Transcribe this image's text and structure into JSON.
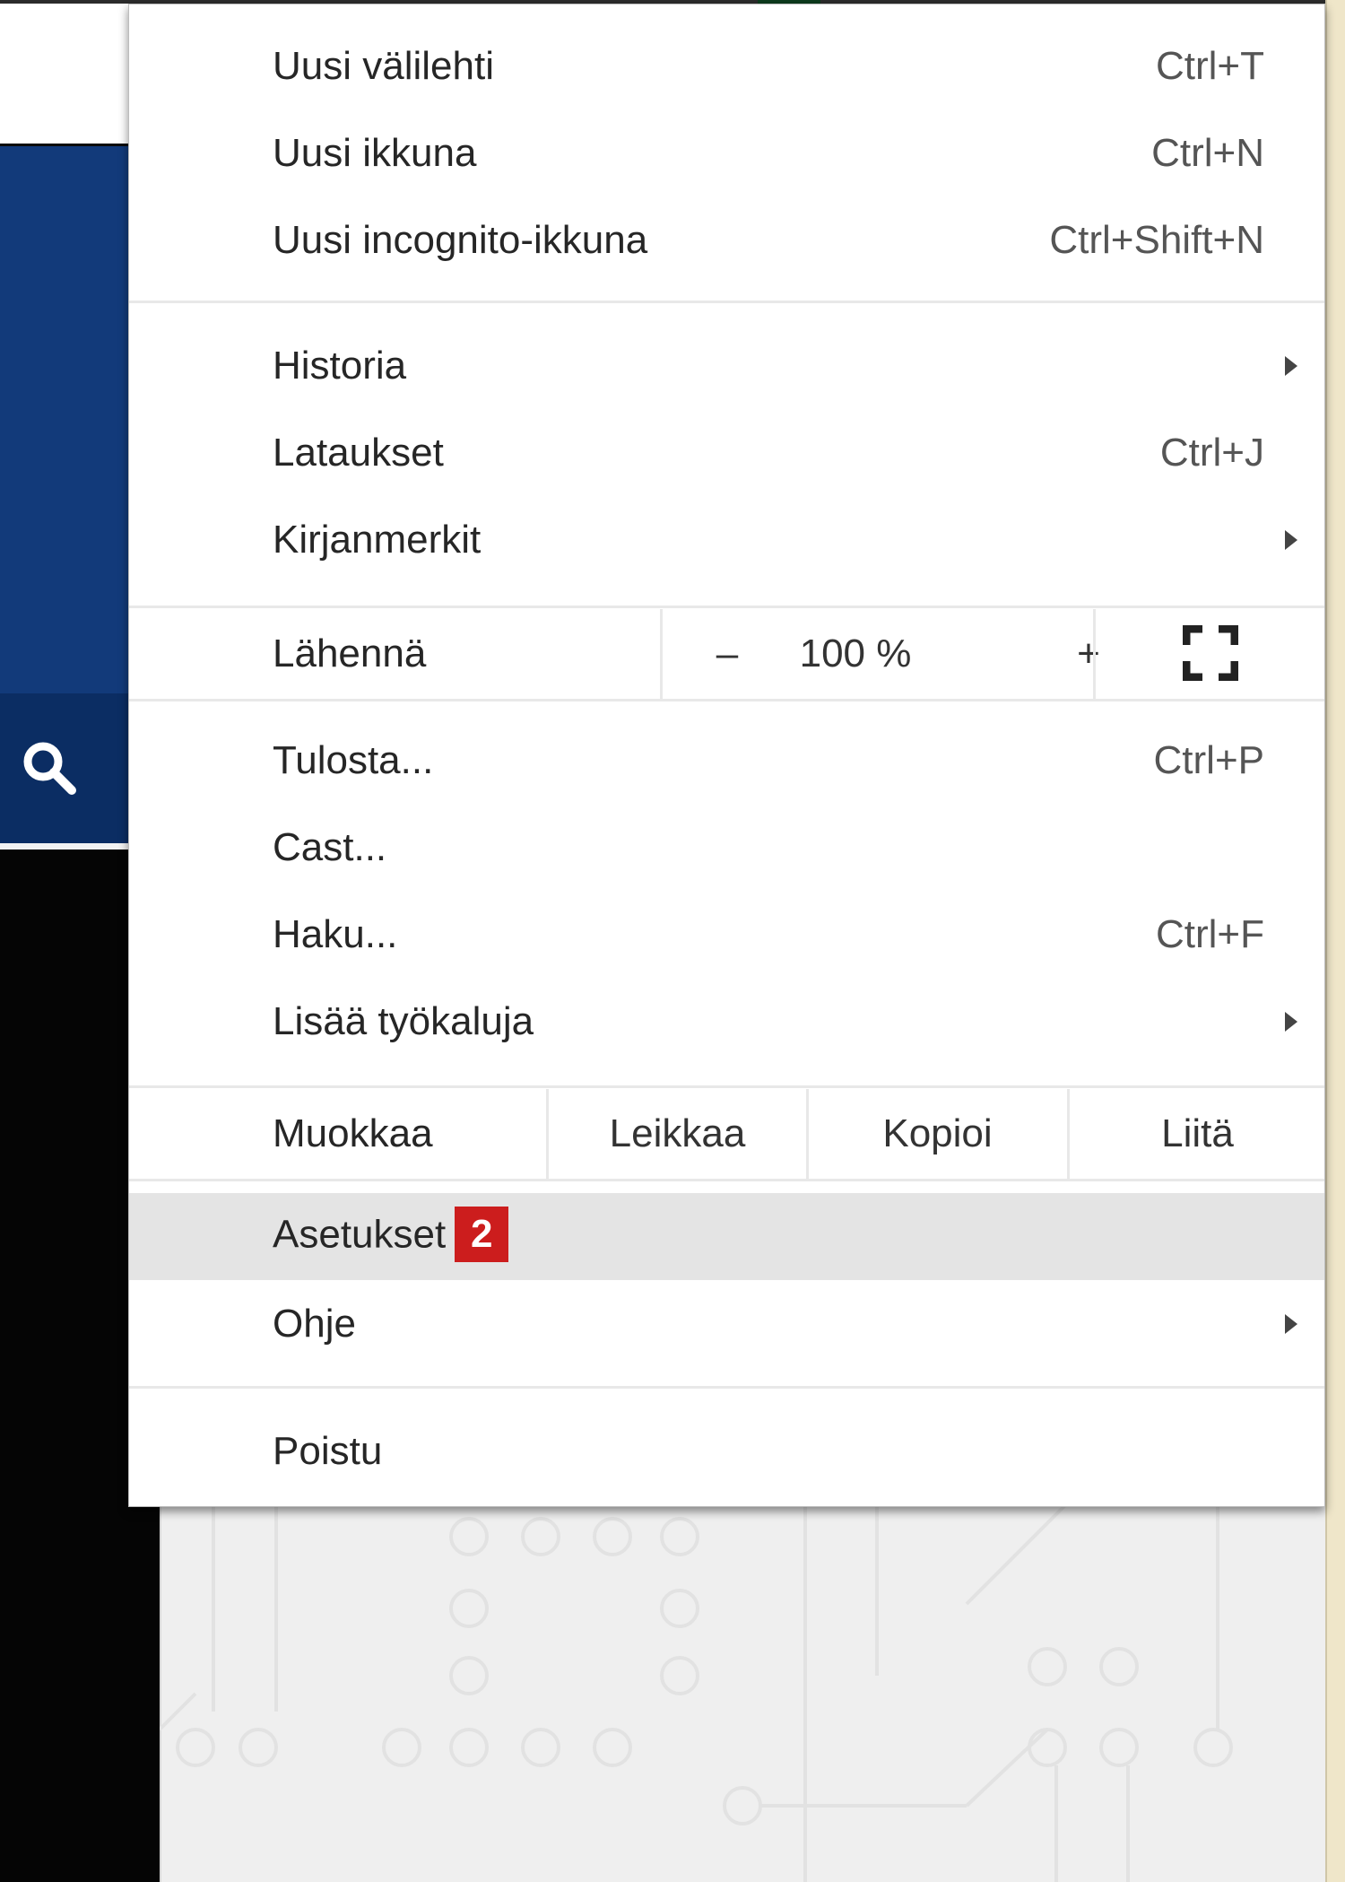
{
  "background": {
    "search_icon": "search-icon",
    "colors": {
      "navy": "#123a7a",
      "dark_navy": "#0b2d63"
    }
  },
  "menu": {
    "group1": [
      {
        "label": "Uusi välilehti",
        "shortcut": "Ctrl+T"
      },
      {
        "label": "Uusi ikkuna",
        "shortcut": "Ctrl+N"
      },
      {
        "label": "Uusi incognito-ikkuna",
        "shortcut": "Ctrl+Shift+N"
      }
    ],
    "group2": [
      {
        "label": "Historia",
        "submenu": true
      },
      {
        "label": "Lataukset",
        "shortcut": "Ctrl+J"
      },
      {
        "label": "Kirjanmerkit",
        "submenu": true
      }
    ],
    "zoom": {
      "label": "Lähennä",
      "minus": "–",
      "level": "100 %",
      "plus": "+",
      "fullscreen_icon": "fullscreen-icon"
    },
    "group3": [
      {
        "label": "Tulosta...",
        "shortcut": "Ctrl+P"
      },
      {
        "label": "Cast..."
      },
      {
        "label": "Haku...",
        "shortcut": "Ctrl+F"
      },
      {
        "label": "Lisää työkaluja",
        "submenu": true
      }
    ],
    "edit": {
      "label": "Muokkaa",
      "cut": "Leikkaa",
      "copy": "Kopioi",
      "paste": "Liitä"
    },
    "settings": {
      "label": "Asetukset",
      "badge": "2",
      "badge_color": "#cc1d1d",
      "highlighted": true
    },
    "help": {
      "label": "Ohje",
      "submenu": true
    },
    "exit": {
      "label": "Poistu"
    }
  }
}
